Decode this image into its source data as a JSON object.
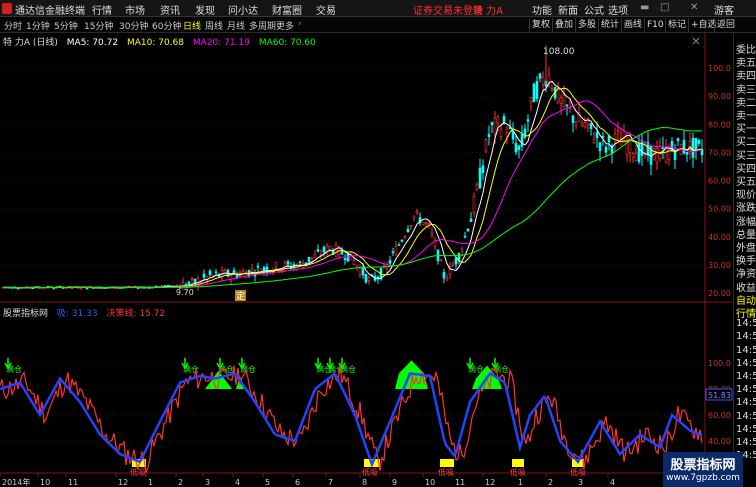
{
  "menubar": {
    "app_title": "通达信金融终端",
    "menus": [
      "行情",
      "市场",
      "资讯",
      "发现",
      "问小达",
      "财富圈",
      "交易"
    ],
    "warning": "证券交易未登录",
    "stock_label": "特 力A",
    "right_items": [
      "功能",
      "新面",
      "公式",
      "选项"
    ],
    "user": "游客"
  },
  "toolbar": {
    "periods": [
      "分时",
      "1分钟",
      "5分钟",
      "15分钟",
      "30分钟",
      "60分钟",
      "日线",
      "周线",
      "月线",
      "多周期",
      "更多"
    ],
    "active_period": "日线",
    "tools": [
      "复权",
      "叠加",
      "多股",
      "统计",
      "画线",
      "F10",
      "标记",
      "+自选",
      "返回"
    ]
  },
  "upper_chart": {
    "title": "特 力A (日线)",
    "ma": [
      {
        "label": "MA5: 70.72",
        "color": "#ffffff"
      },
      {
        "label": "MA10: 70.68",
        "color": "#ffff00"
      },
      {
        "label": "MA20: 71.19",
        "color": "#ff00ff"
      },
      {
        "label": "MA60: 70.60",
        "color": "#00ff00"
      }
    ],
    "y_ticks": [
      "100.0",
      "90.00",
      "80.00",
      "70.00",
      "60.00",
      "50.00",
      "40.00",
      "30.00",
      "20.00"
    ],
    "high_label": "108.00",
    "low_label": "9.70",
    "marker": "定"
  },
  "lower_chart": {
    "title": "股票指标网",
    "legend": [
      {
        "label": "吸: 31.33",
        "color": "#3355ff"
      },
      {
        "label": "决策线: 15.72",
        "color": "#ff3333"
      }
    ],
    "y_ticks": [
      "100.0",
      "80.00",
      "60.00",
      "40.00",
      "20.00"
    ],
    "current_value": "51.83",
    "buy_label": "满仓",
    "low_label": "低吸"
  },
  "x_axis": [
    "2014年",
    "10",
    "11",
    "12",
    "1",
    "2",
    "3",
    "4",
    "5",
    "6",
    "7",
    "8",
    "9",
    "10",
    "11",
    "12",
    "1",
    "2",
    "3",
    "4"
  ],
  "right_panel": [
    "委比",
    "卖五",
    "卖四",
    "卖三",
    "卖二",
    "卖一",
    "买一",
    "买二",
    "买三",
    "买四",
    "买五",
    "现价",
    "涨跌",
    "涨幅",
    "总量",
    "外盘",
    "换手",
    "净资",
    "收益",
    "自动",
    "行情",
    "14:5",
    "14:5",
    "14:5",
    "14:5",
    "14:5",
    "14:5",
    "14:5",
    "14:5",
    "14:5",
    "14:5",
    "14:5"
  ],
  "watermark": {
    "line1": "股票指标网",
    "line2": "www.7gpzb.com"
  },
  "colors": {
    "up": "#ff3333",
    "down": "#00ffff",
    "ma5": "#ffffff",
    "ma10": "#ffff00",
    "ma20": "#ff00ff",
    "ma60": "#00ff00",
    "buy_zone": "#00ff00",
    "low_zone": "#ffff00"
  }
}
